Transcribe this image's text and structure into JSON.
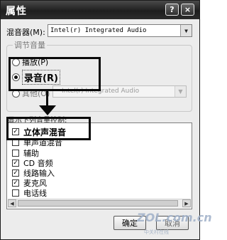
{
  "window": {
    "title": "属性",
    "help_label": "?",
    "close_label": "×"
  },
  "mixer": {
    "label": "混音器(M):",
    "value": "Intel(r) Integrated Audio"
  },
  "adjust_group": {
    "title": "调节音量",
    "options": [
      {
        "label": "播放(P)",
        "selected": false
      },
      {
        "label": "录音(R)",
        "selected": true
      },
      {
        "label": "其他(O)",
        "selected": false
      }
    ],
    "other_select_value": "Intel(r) Integrated Audio"
  },
  "controls": {
    "label": "显示下列音量控制:",
    "items": [
      {
        "label": "立体声混音",
        "checked": true
      },
      {
        "label": "单声道混音",
        "checked": false
      },
      {
        "label": "辅助",
        "checked": false
      },
      {
        "label": "CD 音频",
        "checked": true
      },
      {
        "label": "线路输入",
        "checked": true
      },
      {
        "label": "麦克风",
        "checked": true
      },
      {
        "label": "电话线",
        "checked": false
      }
    ]
  },
  "buttons": {
    "ok": "确定",
    "cancel": "取消"
  },
  "watermark": {
    "main": "ZOL.com.cn",
    "sub": "中关村在线"
  },
  "icons": {
    "check": "✓",
    "dropdown": "▼",
    "scroll_left": "◀",
    "scroll_right": "▶"
  }
}
